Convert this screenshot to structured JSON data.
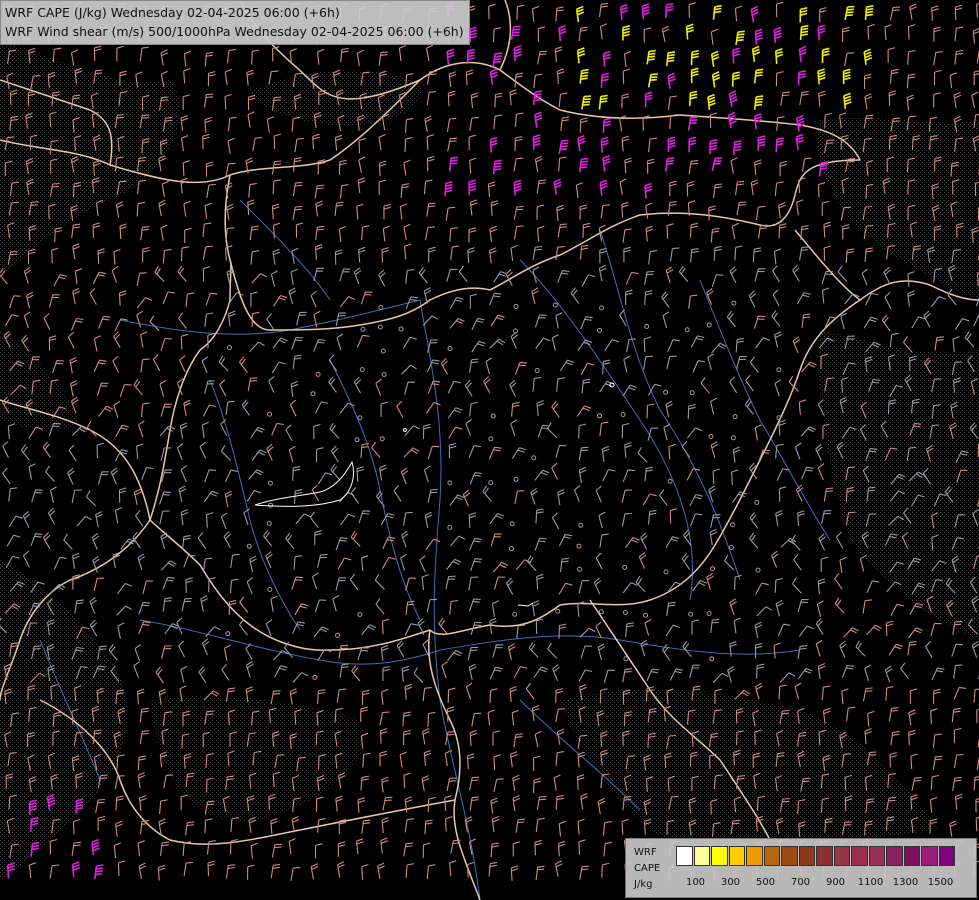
{
  "title": {
    "line1": "WRF CAPE (J/kg) Wednesday 02-04-2025 06:00 (+6h)",
    "line2": "WRF Wind shear (m/s) 500/1000hPa Wednesday 02-04-2025 06:00 (+6h)"
  },
  "legend": {
    "label_line1": "WRF",
    "label_line2": "CAPE",
    "label_line3": "J/kg",
    "ticks": [
      "100",
      "300",
      "500",
      "700",
      "900",
      "1100",
      "1300",
      "1500"
    ],
    "colors": [
      "#ffffff",
      "#ffff99",
      "#ffff00",
      "#ffcc00",
      "#ee9900",
      "#b8660b",
      "#9c4a14",
      "#8b3a1c",
      "#8a3030",
      "#953545",
      "#99304e",
      "#993055",
      "#88205e",
      "#7a1060",
      "#991e7a",
      "#800080"
    ]
  },
  "map_colors": {
    "background": "#000000",
    "border": "#e8c9a3",
    "river": "#3d6fbd",
    "barb_low": "#9a9aa8",
    "barb_mid": "#d08c84",
    "barb_high": "#e85aa0",
    "barb_magenta": "#e020e0",
    "barb_yellow": "#f0f000",
    "terrain_stipple": "#666666"
  }
}
